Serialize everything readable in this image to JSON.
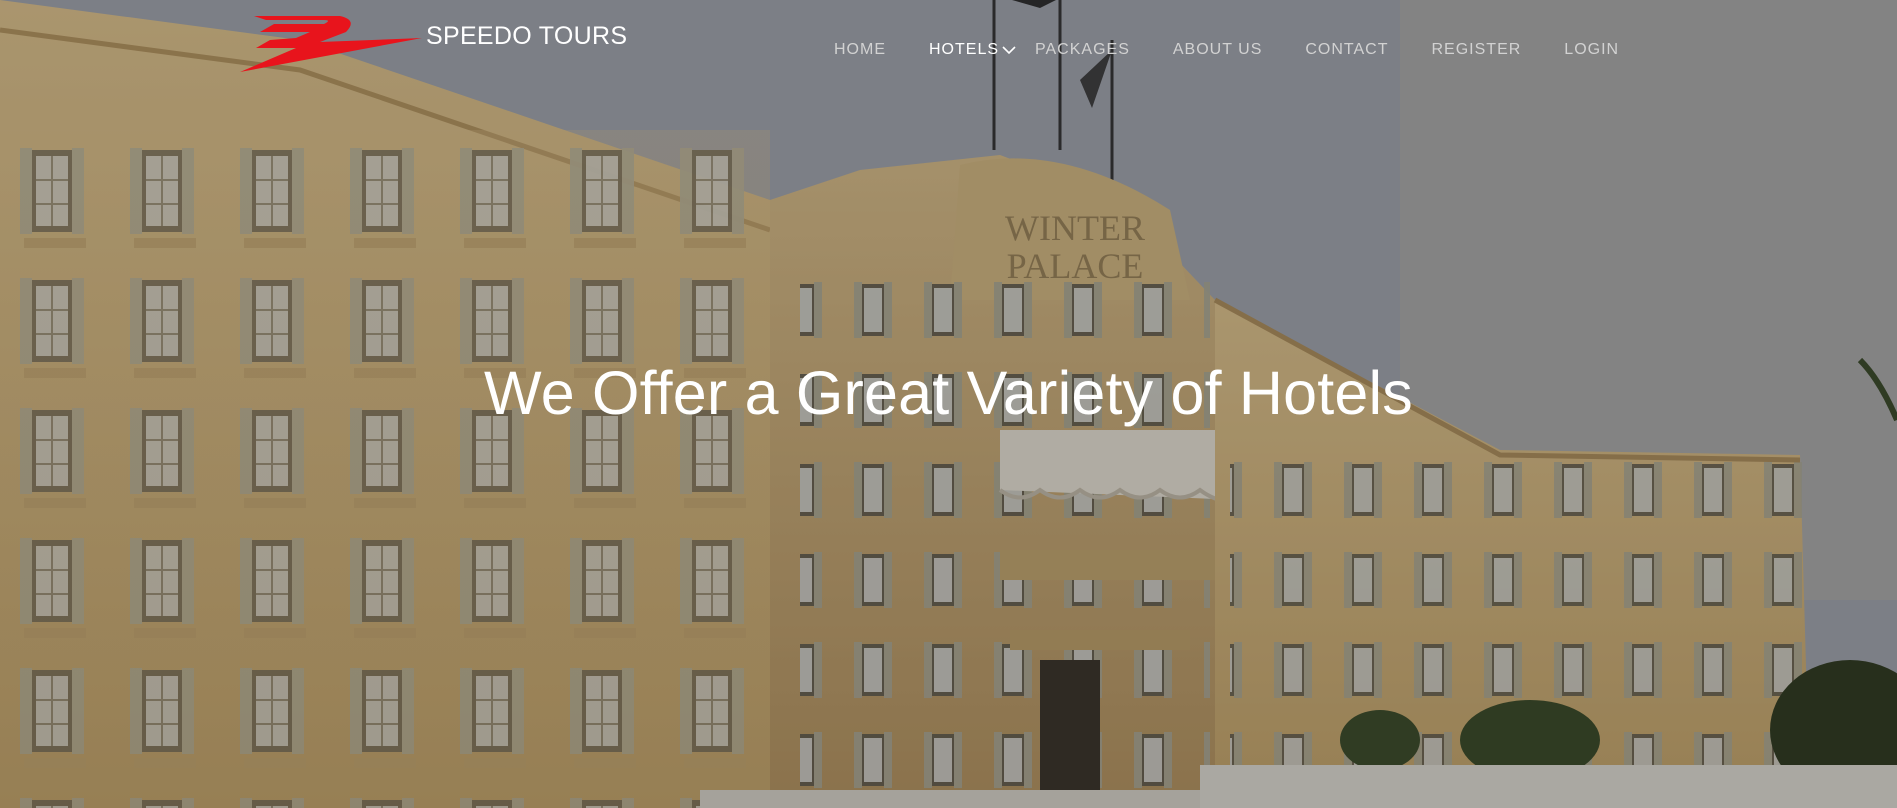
{
  "brand": {
    "name": "SPEEDO TOURS",
    "logo_icon": "speedo-wing-logo-icon",
    "logo_color": "#e8141c"
  },
  "nav": {
    "items": [
      {
        "label": "HOME"
      },
      {
        "label": "HOTELS",
        "active": true,
        "has_dropdown": true
      },
      {
        "label": "PACKAGES"
      },
      {
        "label": "ABOUT US"
      },
      {
        "label": "CONTACT"
      },
      {
        "label": "REGISTER"
      },
      {
        "label": "LOGIN"
      }
    ],
    "dropdown_icon": "chevron-down-icon"
  },
  "hero": {
    "title": "We Offer a Great Variety of Hotels",
    "background": "winter-palace-hotel-photo"
  }
}
